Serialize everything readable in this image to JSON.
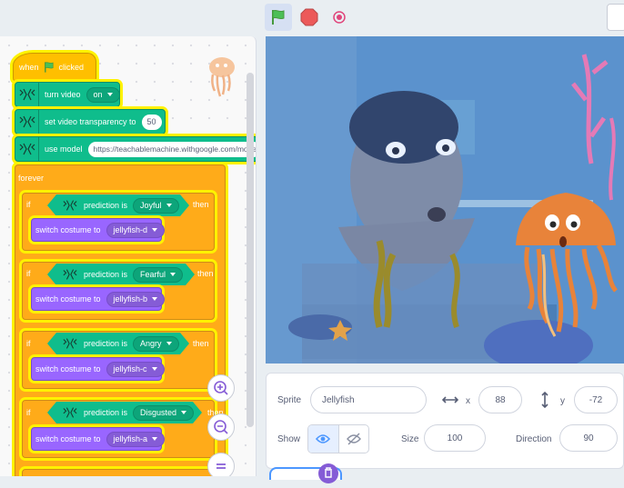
{
  "code": {
    "when": "when",
    "clicked": "clicked",
    "turn_video": "turn video",
    "video_state": "on",
    "set_transparency": "set video transparency to",
    "transparency_value": "50",
    "use_model": "use model",
    "model_url": "https://teachablemachine.withgoogle.com/models/",
    "forever": "forever",
    "if_label": "if",
    "then_label": "then",
    "prediction_is": "prediction is",
    "switch_costume": "switch costume to",
    "branches": [
      {
        "prediction": "Joyful",
        "costume": "jellyfish-d"
      },
      {
        "prediction": "Fearful",
        "costume": "jellyfish-b"
      },
      {
        "prediction": "Angry",
        "costume": "jellyfish-c"
      },
      {
        "prediction": "Disgusted",
        "costume": "jellyfish-a"
      }
    ]
  },
  "sprite_info": {
    "sprite_label": "Sprite",
    "sprite_name": "Jellyfish",
    "x_label": "x",
    "x_value": "88",
    "y_label": "y",
    "y_value": "-72",
    "show_label": "Show",
    "size_label": "Size",
    "size_value": "100",
    "direction_label": "Direction",
    "direction_value": "90"
  },
  "colors": {
    "event": "#ffbf00",
    "extension": "#0fbd8c",
    "control": "#ffab19",
    "looks": "#9966ff",
    "highlight": "#fff200"
  }
}
